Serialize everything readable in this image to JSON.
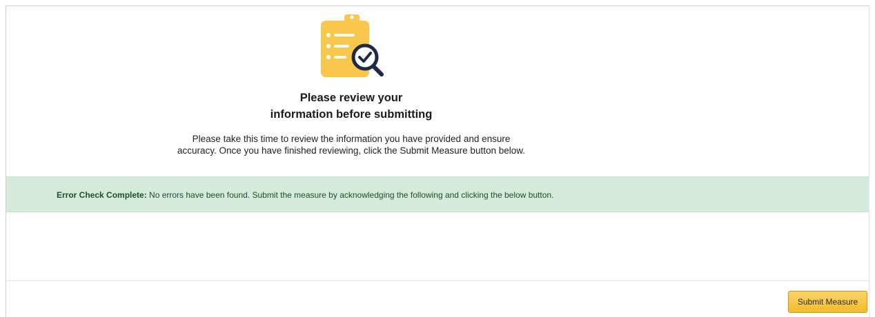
{
  "review": {
    "icon": "clipboard-magnifier-check-icon",
    "title_line1": "Please review your",
    "title_line2": "information before submitting",
    "instructions_line1": "Please take this time to review the information you have provided and ensure",
    "instructions_line2": "accuracy. Once you have finished reviewing, click the Submit Measure button below."
  },
  "alert": {
    "label": "Error Check Complete:",
    "message": " No errors have been found. Submit the measure by acknowledging the following and clicking the below button.",
    "color": "#d4eadb"
  },
  "footer": {
    "submit_label": "Submit Measure",
    "button_color": "#f3bb2b"
  },
  "colors": {
    "icon_yellow": "#f9c74b",
    "icon_dark": "#1f2a44"
  }
}
